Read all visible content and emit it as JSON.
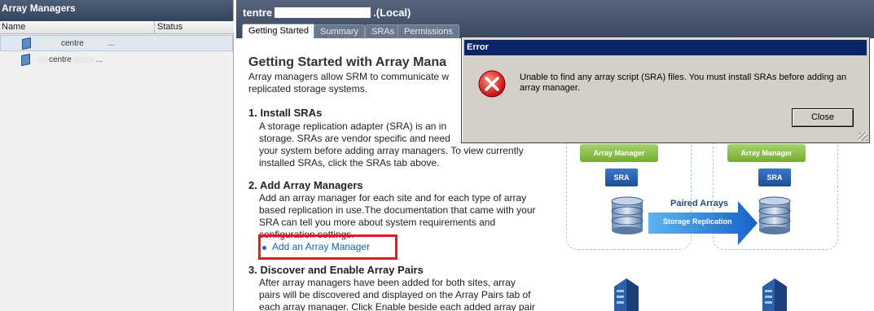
{
  "left_panel": {
    "title": "Array Managers",
    "columns": [
      "Name",
      "Status"
    ],
    "rows": [
      {
        "pre": "",
        "name": "centre",
        "trail": "..."
      },
      {
        "pre": "",
        "name": "centre",
        "trail": "..."
      }
    ]
  },
  "header": {
    "server_prefix": "t",
    "server_mid": "entre",
    "server_suffix": ".(Local)"
  },
  "tabs": [
    {
      "label": "Getting Started"
    },
    {
      "label": "Summary"
    },
    {
      "label": "SRAs"
    },
    {
      "label": "Permissions"
    }
  ],
  "content": {
    "heading": "Getting Started with Array Mana",
    "intro": [
      "Array managers allow SRM to communicate w",
      "replicated storage systems."
    ],
    "s1_title": "1. Install SRAs",
    "s1_lines": [
      "A storage replication adapter (SRA) is an in",
      "storage. SRAs are vendor specific and need",
      "your system before adding array managers. To view currently",
      "installed SRAs, click the SRAs tab above."
    ],
    "s2_title": "2. Add Array Managers",
    "s2_lines": [
      "Add an array manager for each site and for each type of array",
      "based replication in use.The documentation that came with your",
      "SRA can tell you more about system requirements and",
      "configuration settings."
    ],
    "link": "Add an Array Manager",
    "s3_title": "3. Discover and Enable Array Pairs",
    "s3_lines": [
      "After array managers have been added for both sites, array",
      "pairs will be discovered and displayed on the Array Pairs tab of",
      "each array manager. Click Enable beside each added array pair"
    ]
  },
  "diagram": {
    "array_manager": "Array Manager",
    "sra": "SRA",
    "paired_arrays": "Paired Arrays",
    "storage_replication": "Storage Replication"
  },
  "dialog": {
    "title": "Error",
    "message": "Unable to find any array script (SRA) files. You must install SRAs before adding an array manager.",
    "close": "Close",
    "icon": "error-icon"
  }
}
